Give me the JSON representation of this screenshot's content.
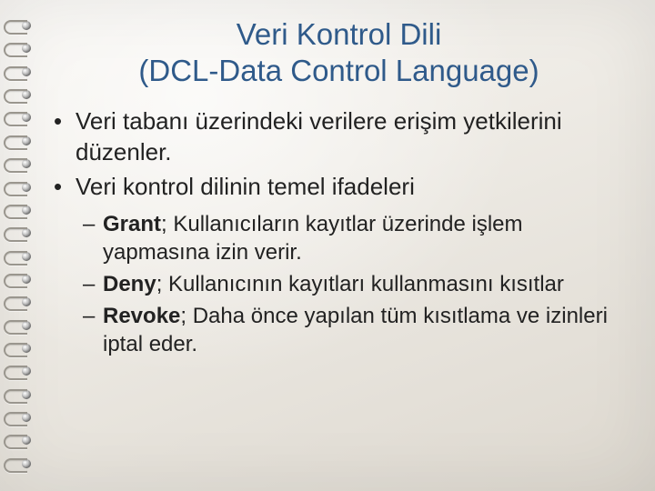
{
  "title_line1": "Veri Kontrol Dili",
  "title_line2": "(DCL-Data Control Language)",
  "bullets": [
    "Veri tabanı üzerindeki verilere erişim yetkilerini düzenler.",
    "Veri kontrol dilinin temel ifadeleri"
  ],
  "subs": [
    {
      "term": "Grant",
      "desc": "; Kullanıcıların kayıtlar üzerinde işlem yapmasına izin verir."
    },
    {
      "term": "Deny",
      "desc": "; Kullanıcının kayıtları kullanmasını kısıtlar"
    },
    {
      "term": "Revoke",
      "desc": "; Daha önce yapılan tüm kısıtlama ve izinleri iptal eder."
    }
  ]
}
